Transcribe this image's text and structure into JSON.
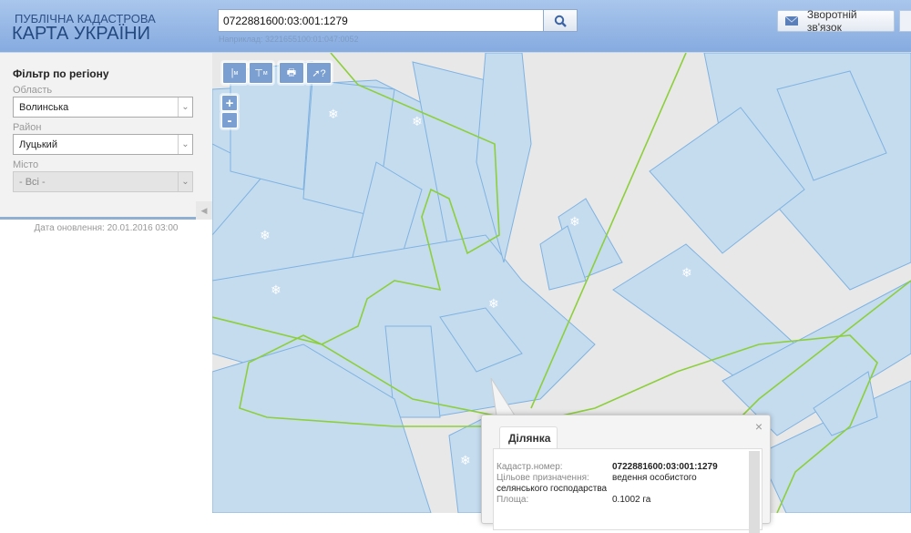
{
  "header": {
    "logo_line1": "ПУБЛІЧНА КАДАСТРОВА",
    "logo_line2": "КАРТА УКРАЇНИ",
    "search_value": "0722881600:03:001:1279",
    "search_hint": "Наприклад: 3221655100:01:047:0052",
    "feedback_label": "Зворотній зв'язок"
  },
  "sidebar": {
    "title": "Фільтр по регіону",
    "oblast_label": "Область",
    "oblast_value": "Волинська",
    "rayon_label": "Район",
    "rayon_value": "Луцький",
    "misto_label": "Місто",
    "misto_value": "- Всі -",
    "updated": "Дата оновлення: 20.01.2016 03:00"
  },
  "toolbar": {
    "measure_length": "м",
    "measure_area": "м",
    "plus": "+",
    "minus": "-"
  },
  "popup": {
    "tab": "Ділянка",
    "close": "×",
    "rows": [
      {
        "label": "Кадастр.номер:",
        "value": "0722881600:03:001:1279"
      },
      {
        "label": "Цільове призначення:",
        "value": "ведення особистого",
        "value_cont": "селянського господарства"
      },
      {
        "label": "Площа:",
        "value": "0.1002 га"
      }
    ]
  },
  "colors": {
    "parcel": "#c5dcef",
    "parcel_border": "#7fb2e0",
    "boundary": "#8ccf3a",
    "header": "#93b5e4"
  }
}
